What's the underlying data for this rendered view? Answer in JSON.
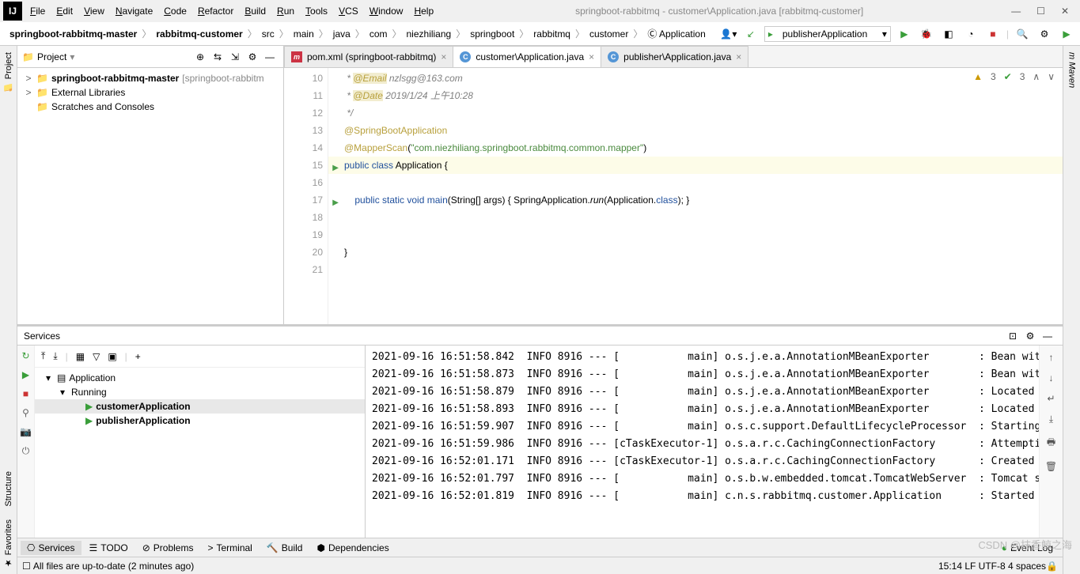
{
  "window": {
    "title": "springboot-rabbitmq - customer\\Application.java [rabbitmq-customer]"
  },
  "menu": [
    "File",
    "Edit",
    "View",
    "Navigate",
    "Code",
    "Refactor",
    "Build",
    "Run",
    "Tools",
    "VCS",
    "Window",
    "Help"
  ],
  "breadcrumb": {
    "bold": [
      "springboot-rabbitmq-master",
      "rabbitmq-customer"
    ],
    "rest": [
      "src",
      "main",
      "java",
      "com",
      "niezhiliang",
      "springboot",
      "rabbitmq",
      "customer"
    ],
    "file": "Application"
  },
  "run_config": "publisherApplication",
  "project": {
    "title": "Project",
    "items": [
      {
        "indent": 0,
        "arrow": ">",
        "icon": "dir",
        "text": "springboot-rabbitmq-master",
        "suffix": " [springboot-rabbitm",
        "bold": true
      },
      {
        "indent": 0,
        "arrow": ">",
        "icon": "lib",
        "text": "External Libraries"
      },
      {
        "indent": 0,
        "arrow": "",
        "icon": "scratch",
        "text": "Scratches and Consoles"
      }
    ]
  },
  "tabs": [
    {
      "icon": "m",
      "label": "pom.xml (springboot-rabbitmq)",
      "active": false
    },
    {
      "icon": "c",
      "label": "customer\\Application.java",
      "active": true
    },
    {
      "icon": "c",
      "label": "publisher\\Application.java",
      "active": false
    }
  ],
  "editor": {
    "warn_a": "3",
    "warn_b": "3",
    "lines": [
      {
        "n": 10,
        "html": " * <span class='c-ann-bg c-ann'>@Email</span> <span class='c-doc'>nzlsgg@163.com</span>",
        "doc": true
      },
      {
        "n": 11,
        "html": " * <span class='c-ann-bg c-ann'>@Date</span> <span class='c-doc'>2019/1/24 上午10:28</span>",
        "doc": true
      },
      {
        "n": 12,
        "html": " */",
        "doc": true
      },
      {
        "n": 13,
        "html": "<span class='c-ann'>@SpringBootApplication</span>"
      },
      {
        "n": 14,
        "html": "<span class='c-ann'>@MapperScan</span>(<span class='c-str'>\"com.niezhiliang.springboot.rabbitmq.common.mapper\"</span>)"
      },
      {
        "n": 15,
        "run": true,
        "hl": true,
        "html": "<span class='c-kw'>public class</span> Application {"
      },
      {
        "n": 16,
        "html": ""
      },
      {
        "n": 17,
        "run": true,
        "html": "    <span class='c-kw'>public static void</span> <span style='color:#1f4f9c'>main</span>(String[] args) { SpringApplication.<span class='c-it'>run</span>(Application.<span class='c-kw'>class</span>); }"
      },
      {
        "n": 18,
        "html": ""
      },
      {
        "n": 19,
        "html": ""
      },
      {
        "n": 20,
        "html": "}"
      },
      {
        "n": 21,
        "html": ""
      }
    ]
  },
  "services": {
    "title": "Services",
    "tree": [
      {
        "indent": 0,
        "arrow": "v",
        "icon": "app",
        "text": "Application"
      },
      {
        "indent": 1,
        "arrow": "v",
        "icon": "",
        "text": "Running"
      },
      {
        "indent": 2,
        "arrow": "",
        "icon": "play",
        "text": "customerApplication",
        "bold": true,
        "sel": true
      },
      {
        "indent": 2,
        "arrow": "",
        "icon": "play",
        "text": "publisherApplication",
        "bold": true
      }
    ],
    "log": [
      "2021-09-16 16:51:58.842  INFO 8916 --- [           main] o.s.j.e.a.AnnotationMBeanExporter        : Bean wit",
      "2021-09-16 16:51:58.873  INFO 8916 --- [           main] o.s.j.e.a.AnnotationMBeanExporter        : Bean wit",
      "2021-09-16 16:51:58.879  INFO 8916 --- [           main] o.s.j.e.a.AnnotationMBeanExporter        : Located ",
      "2021-09-16 16:51:58.893  INFO 8916 --- [           main] o.s.j.e.a.AnnotationMBeanExporter        : Located ",
      "2021-09-16 16:51:59.907  INFO 8916 --- [           main] o.s.c.support.DefaultLifecycleProcessor  : Starting",
      "2021-09-16 16:51:59.986  INFO 8916 --- [cTaskExecutor-1] o.s.a.r.c.CachingConnectionFactory       : Attempti",
      "2021-09-16 16:52:01.171  INFO 8916 --- [cTaskExecutor-1] o.s.a.r.c.CachingConnectionFactory       : Created ",
      "2021-09-16 16:52:01.797  INFO 8916 --- [           main] o.s.b.w.embedded.tomcat.TomcatWebServer  : Tomcat s",
      "2021-09-16 16:52:01.819  INFO 8916 --- [           main] c.n.s.rabbitmq.customer.Application      : Started "
    ]
  },
  "bottom_tabs": [
    "Services",
    "TODO",
    "Problems",
    "Terminal",
    "Build",
    "Dependencies"
  ],
  "bottom_right": "Event Log",
  "status": {
    "left": "All files are up-to-date (2 minutes ago)",
    "right": "15:14   LF   UTF-8   4 spaces   ",
    "watermark": "CSDN @抹香鲸之海"
  }
}
